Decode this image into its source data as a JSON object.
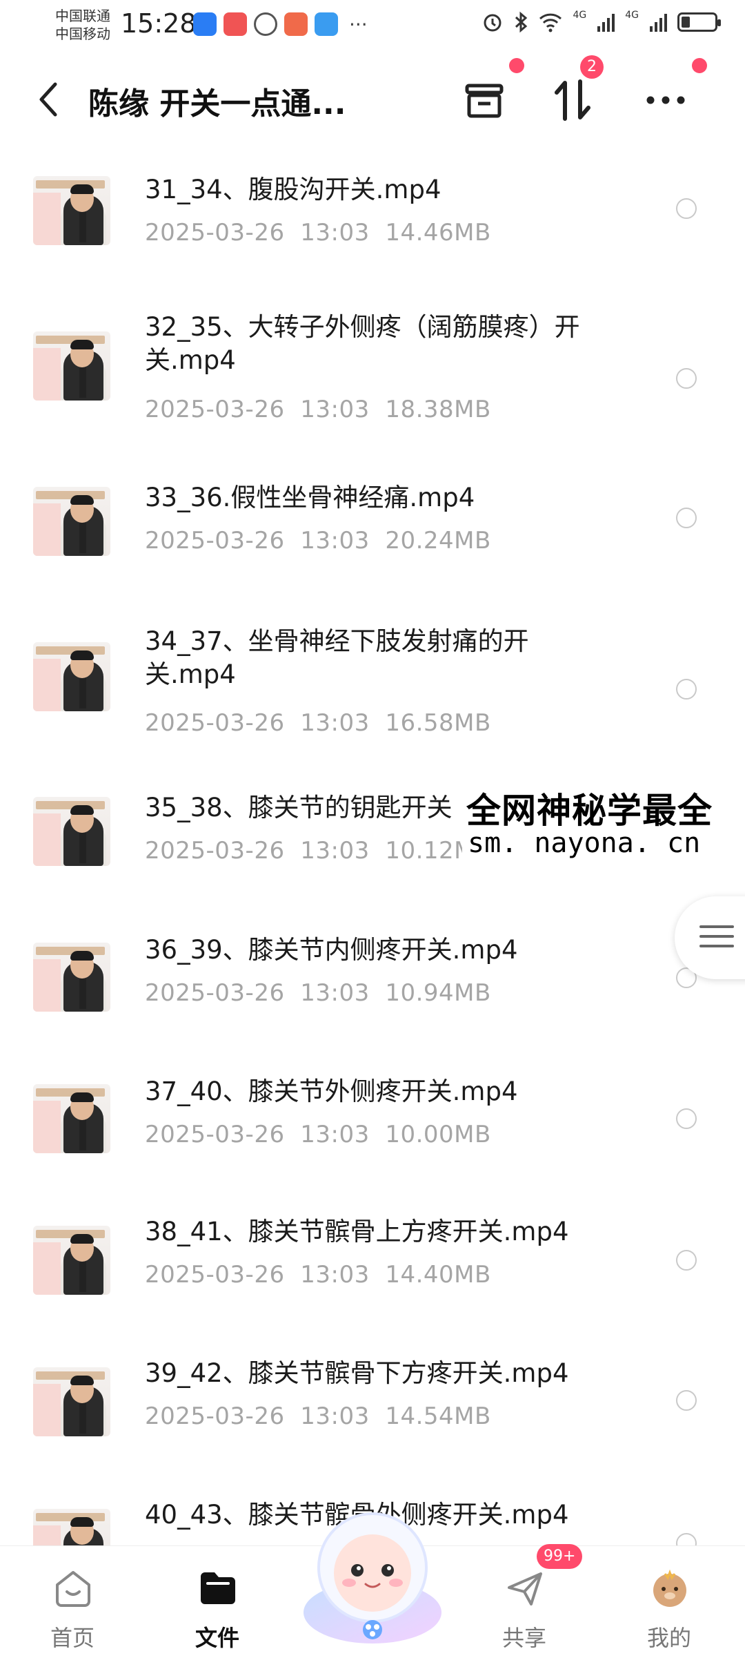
{
  "status_bar": {
    "carrier1": "中国联通",
    "carrier2": "中国移动",
    "time": "15:28",
    "more": "···",
    "network1": "4G",
    "network2": "4G"
  },
  "header": {
    "title": "陈缘 开关一点通...",
    "sort_badge": "2"
  },
  "files": [
    {
      "name": "31_34、腹股沟开关.mp4",
      "date": "2025-03-26",
      "time": "13:03",
      "size": "14.46MB"
    },
    {
      "name": "32_35、大转子外侧疼（阔筋膜疼）开关.mp4",
      "date": "2025-03-26",
      "time": "13:03",
      "size": "18.38MB"
    },
    {
      "name": "33_36.假性坐骨神经痛.mp4",
      "date": "2025-03-26",
      "time": "13:03",
      "size": "20.24MB"
    },
    {
      "name": "34_37、坐骨神经下肢发射痛的开关.mp4",
      "date": "2025-03-26",
      "time": "13:03",
      "size": "16.58MB"
    },
    {
      "name": "35_38、膝关节的钥匙开关",
      "date": "2025-03-26",
      "time": "13:03",
      "size": "10.12M"
    },
    {
      "name": "36_39、膝关节内侧疼开关.mp4",
      "date": "2025-03-26",
      "time": "13:03",
      "size": "10.94MB"
    },
    {
      "name": "37_40、膝关节外侧疼开关.mp4",
      "date": "2025-03-26",
      "time": "13:03",
      "size": "10.00MB"
    },
    {
      "name": "38_41、膝关节髌骨上方疼开关.mp4",
      "date": "2025-03-26",
      "time": "13:03",
      "size": "14.40MB"
    },
    {
      "name": "39_42、膝关节髌骨下方疼开关.mp4",
      "date": "2025-03-26",
      "time": "13:03",
      "size": "14.54MB"
    },
    {
      "name": "40_43、膝关节髌骨外侧疼开关.mp4",
      "date": "",
      "time": "",
      "size": ""
    }
  ],
  "watermark": {
    "line1": "全网神秘学最全",
    "line2": "sm. nayona. cn"
  },
  "bottom_nav": {
    "home": "首页",
    "files": "文件",
    "share": "共享",
    "mine": "我的",
    "share_badge": "99+"
  },
  "colors": {
    "accent": "#ff4a6b",
    "meta_text": "#a5a5a5"
  }
}
